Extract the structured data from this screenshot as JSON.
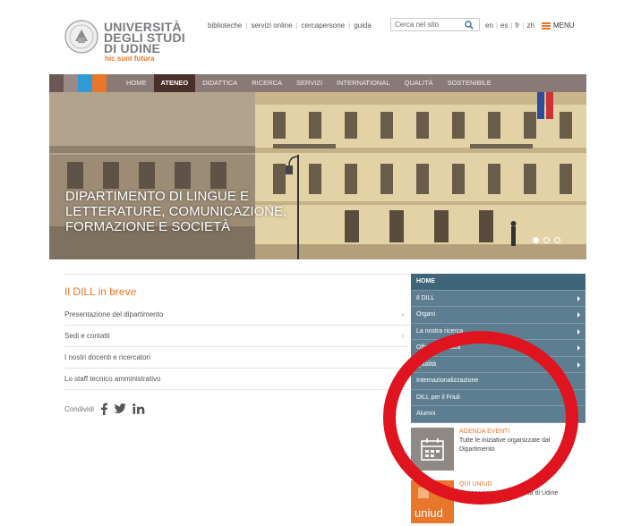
{
  "header": {
    "logo": {
      "line1": "UNIVERSITÀ",
      "line2": "DEGLI STUDI",
      "line3": "DI UDINE",
      "motto": "hic sunt futura"
    },
    "top_links": [
      "biblioteche",
      "servizi online",
      "cercapersone",
      "guida"
    ],
    "search": {
      "placeholder": "Cerca nel sito",
      "icon": "search-icon"
    },
    "languages": [
      "en",
      "es",
      "fr",
      "zh"
    ],
    "menu_label": "MENU"
  },
  "nav": {
    "swatch_colors": [
      "#6b5753",
      "#9a8a87",
      "#2f9ad6",
      "#e8762b"
    ],
    "items": [
      {
        "label": "HOME",
        "active": false
      },
      {
        "label": "ATENEO",
        "active": true
      },
      {
        "label": "DIDATTICA",
        "active": false
      },
      {
        "label": "RICERCA",
        "active": false
      },
      {
        "label": "SERVIZI",
        "active": false
      },
      {
        "label": "INTERNATIONAL",
        "active": false
      },
      {
        "label": "QUALITÀ",
        "active": false
      },
      {
        "label": "SOSTENIBILE",
        "active": false
      }
    ]
  },
  "hero": {
    "caption_line1": "DIPARTIMENTO DI LINGUE E",
    "caption_line2": "LETTERATURE, COMUNICAZIONE,",
    "caption_line3": "FORMAZIONE E SOCIETÀ"
  },
  "main": {
    "section_title": "Il DILL in breve",
    "links": [
      {
        "label": "Presentazione del dipartimento",
        "has_arrow": true
      },
      {
        "label": "Sedi e contatti",
        "has_arrow": true
      },
      {
        "label": "I nostri docenti e ricercatori",
        "has_arrow": false
      },
      {
        "label": "Lo staff tecnico amministrativo",
        "has_arrow": true
      }
    ],
    "share_label": "Condividi"
  },
  "sidebar": {
    "items": [
      {
        "label": "HOME",
        "has_arrow": false
      },
      {
        "label": "Il DILL",
        "has_arrow": true
      },
      {
        "label": "Organi",
        "has_arrow": true
      },
      {
        "label": "La nostra ricerca",
        "has_arrow": true
      },
      {
        "label": "Offerta didattica",
        "has_arrow": true
      },
      {
        "label": "Qualità",
        "has_arrow": true
      },
      {
        "label": "Internazionalizzazione",
        "has_arrow": false
      },
      {
        "label": "DILL per il Friuli",
        "has_arrow": false
      },
      {
        "label": "Alumni",
        "has_arrow": false
      }
    ]
  },
  "promos": {
    "agenda": {
      "title": "AGENDA EVENTI",
      "line1": "Tutte le iniziative organizzate dal",
      "line2": "Dipartimento",
      "icon": "calendar-icon"
    },
    "uniud": {
      "title": "QUI UNIUD",
      "text": "E-magazine dell'Università di Udine",
      "badge": "uniud"
    }
  },
  "colors": {
    "accent": "#e8762b",
    "nav_bg": "#8a7a77",
    "nav_active": "#4a2f2b",
    "sidebar_bg": "#5d7e90",
    "annotation": "#e0141e"
  }
}
